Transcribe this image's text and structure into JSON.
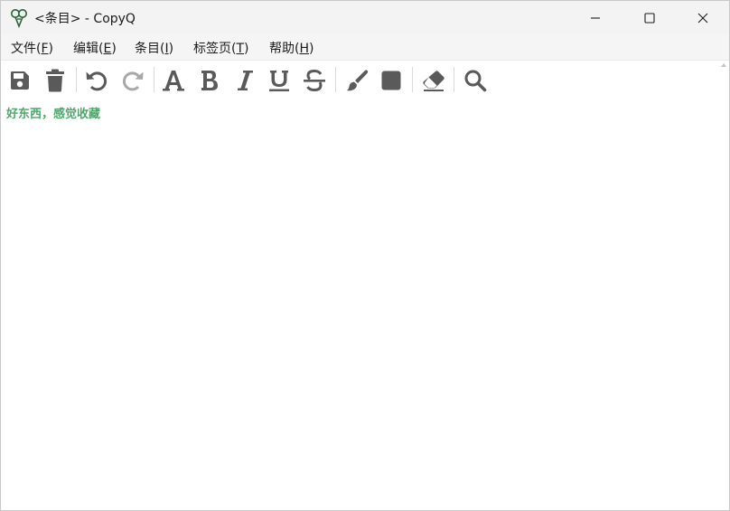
{
  "window": {
    "title": "<条目> - CopyQ",
    "controls": {
      "minimize": "minimize-icon",
      "maximize": "maximize-icon",
      "close": "close-icon"
    }
  },
  "menu": {
    "items": [
      {
        "label": "文件(",
        "key": "F",
        "end": ")"
      },
      {
        "label": "编辑(",
        "key": "E",
        "end": ")"
      },
      {
        "label": "条目(",
        "key": "I",
        "end": ")"
      },
      {
        "label": "标签页(",
        "key": "T",
        "end": ")"
      },
      {
        "label": "帮助(",
        "key": "H",
        "end": ")"
      }
    ]
  },
  "toolbar": {
    "tools": [
      "save-icon",
      "trash-icon",
      "undo-icon",
      "redo-icon",
      "font-icon",
      "bold-icon",
      "italic-icon",
      "underline-icon",
      "strikethrough-icon",
      "brush-icon",
      "background-color-icon",
      "eraser-icon",
      "search-icon"
    ],
    "letters": {
      "font": "A",
      "bold": "B",
      "italic": "I",
      "underline": "U",
      "strike": "S"
    }
  },
  "editor": {
    "content": "好东西，感觉收藏"
  },
  "colors": {
    "text_accent": "#4da76a",
    "icon": "#5a5a5a",
    "icon_disabled": "#a8a8a8"
  }
}
